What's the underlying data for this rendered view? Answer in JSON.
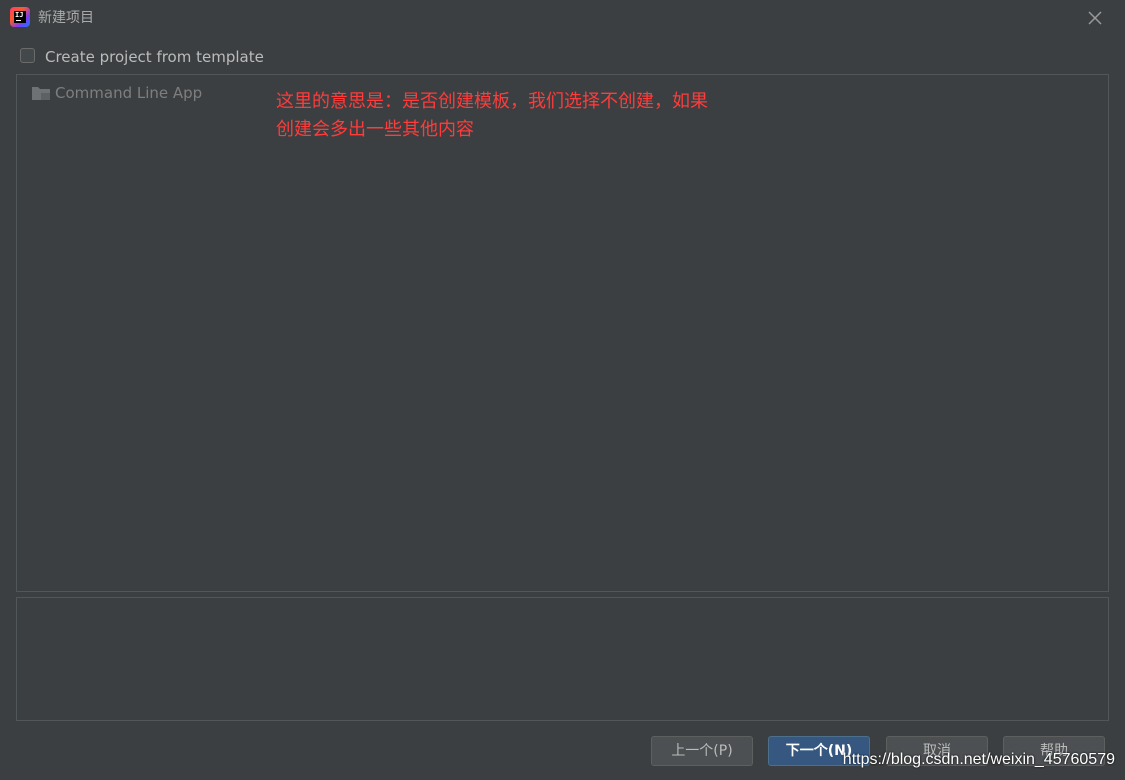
{
  "window": {
    "title": "新建项目",
    "app_icon": "intellij-idea-icon",
    "app_icon_text": "IJ",
    "close_icon": "close-icon"
  },
  "template_option": {
    "checkbox_label": "Create project from template",
    "checked": false
  },
  "template_list": {
    "items": [
      {
        "label": "Command Line App",
        "icon": "folder-icon"
      }
    ]
  },
  "annotation": {
    "line1": "这里的意思是：是否创建模板，我们选择不创建，如果",
    "line2": "创建会多出一些其他内容",
    "color": "#ff3b3b"
  },
  "footer": {
    "prev_label": "上一个(P)",
    "next_label": "下一个(N)",
    "cancel_label": "取消",
    "help_label": "帮助"
  },
  "watermark": {
    "text": "https://blog.csdn.net/weixin_45760579"
  },
  "colors": {
    "background": "#3c3f41",
    "primary_button": "#365880"
  }
}
